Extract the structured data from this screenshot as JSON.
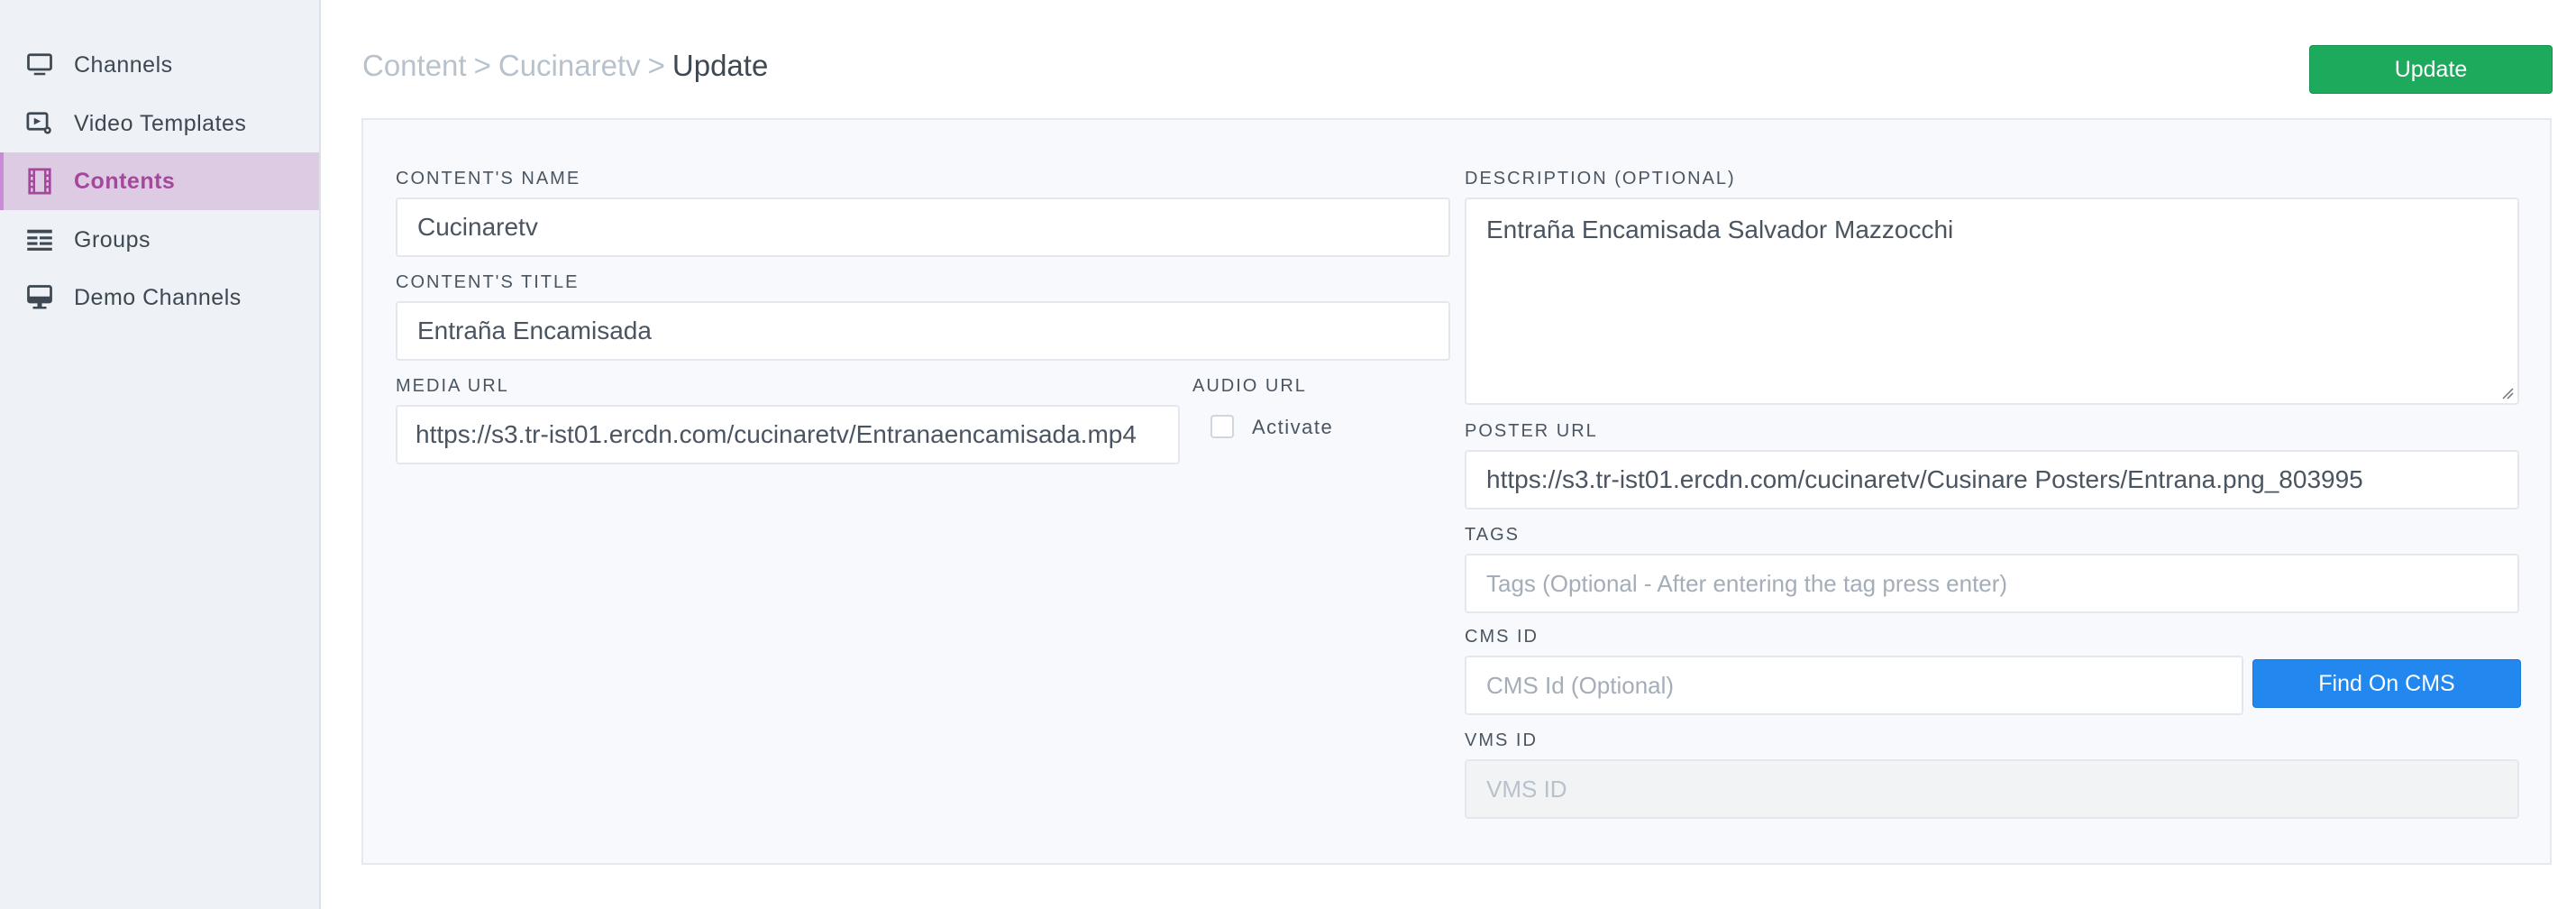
{
  "sidebar": {
    "items": [
      {
        "label": "Channels",
        "icon": "monitor-icon"
      },
      {
        "label": "Video Templates",
        "icon": "video-settings-icon"
      },
      {
        "label": "Contents",
        "icon": "film-icon",
        "active": true
      },
      {
        "label": "Groups",
        "icon": "groups-icon"
      },
      {
        "label": "Demo Channels",
        "icon": "demo-display-icon"
      }
    ]
  },
  "header": {
    "breadcrumb": [
      "Content",
      "Cucinaretv",
      "Update"
    ],
    "separator": ">",
    "update_label": "Update"
  },
  "form": {
    "content_name": {
      "label": "CONTENT'S NAME",
      "value": "Cucinaretv"
    },
    "content_title": {
      "label": "CONTENT'S TITLE",
      "value": "Entraña Encamisada"
    },
    "media_url": {
      "label": "MEDIA URL",
      "value": "https://s3.tr-ist01.ercdn.com/cucinaretv/Entranaencamisada.mp4"
    },
    "audio_url": {
      "label": "AUDIO URL",
      "checkbox_label": "Activate",
      "checked": false
    },
    "description": {
      "label": "DESCRIPTION (OPTIONAL)",
      "value": "Entraña Encamisada Salvador Mazzocchi"
    },
    "poster_url": {
      "label": "POSTER URL",
      "value": "https://s3.tr-ist01.ercdn.com/cucinaretv/Cusinare Posters/Entrana.png_803995"
    },
    "tags": {
      "label": "TAGS",
      "placeholder": "Tags (Optional - After entering the tag press enter)"
    },
    "cms_id": {
      "label": "CMS ID",
      "placeholder": "CMS Id (Optional)",
      "button_label": "Find On CMS"
    },
    "vms_id": {
      "label": "VMS ID",
      "placeholder": "VMS ID"
    }
  },
  "colors": {
    "accent_active": "#a5489b",
    "update_button": "#1eaa5d",
    "cms_button": "#2288f0"
  }
}
